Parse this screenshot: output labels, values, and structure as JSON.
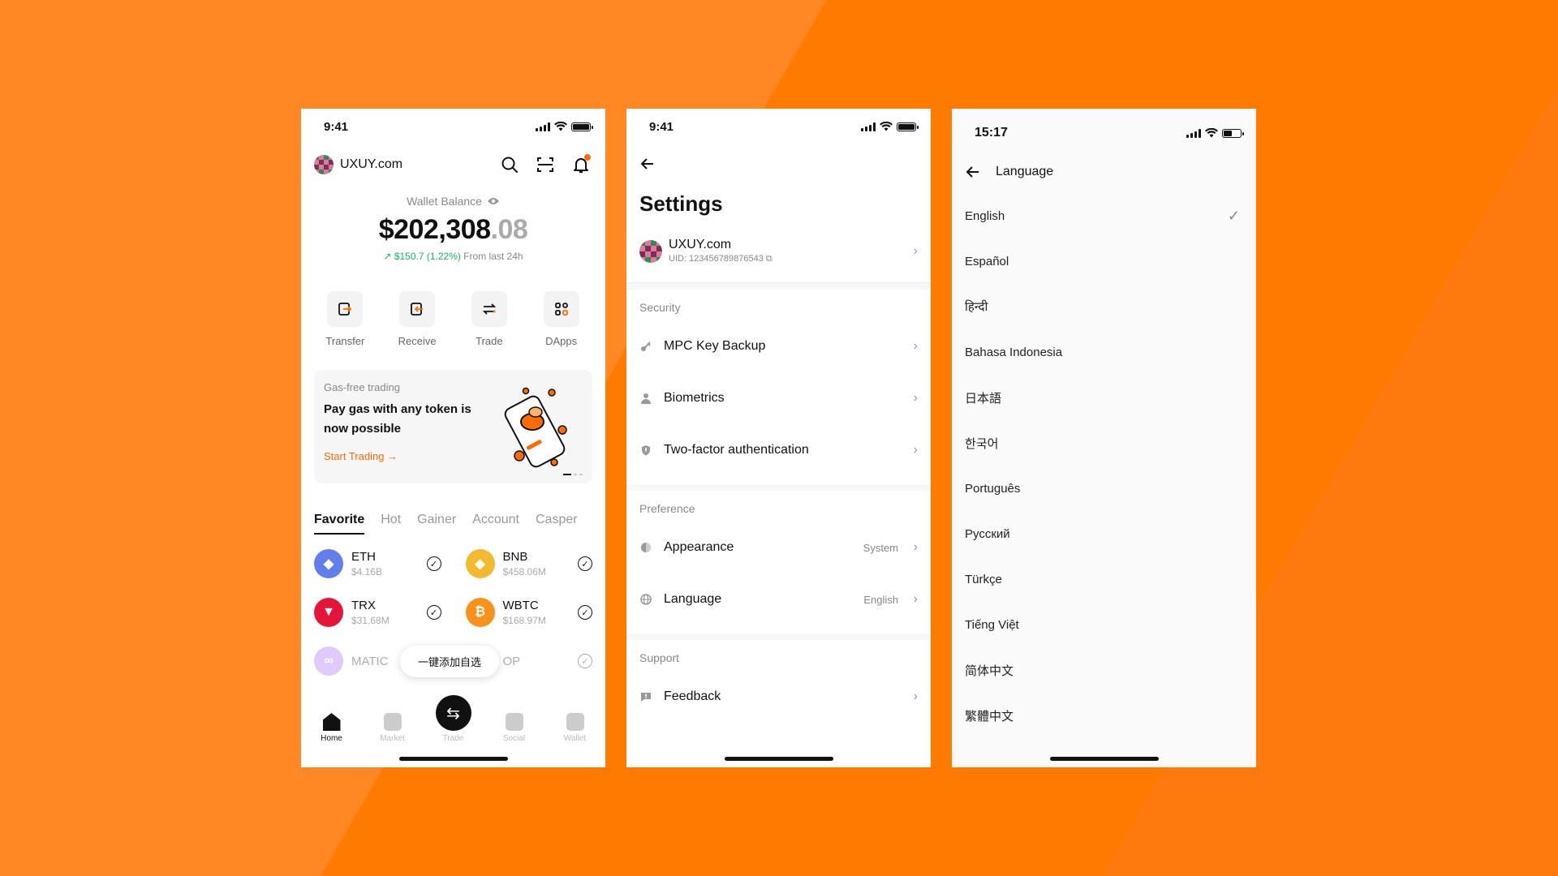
{
  "colors": {
    "accent": "#ff6b00",
    "background": "#ff7a00",
    "positive": "#18b85a"
  },
  "home": {
    "status": {
      "time": "9:41"
    },
    "brand": "UXUY.com",
    "balance_label": "Wallet Balance",
    "balance_main": "$202,308",
    "balance_decimal": ".08",
    "change_value": "$150.7 (1.22%)",
    "change_suffix": "From last 24h",
    "actions": [
      {
        "label": "Transfer",
        "icon": "transfer-icon"
      },
      {
        "label": "Receive",
        "icon": "receive-icon"
      },
      {
        "label": "Trade",
        "icon": "trade-icon"
      },
      {
        "label": "DApps",
        "icon": "dapps-icon"
      }
    ],
    "promo": {
      "subtitle": "Gas-free trading",
      "title": "Pay gas with any token is now possible",
      "link": "Start Trading →"
    },
    "tabs": [
      "Favorite",
      "Hot",
      "Gainer",
      "Account",
      "Casper"
    ],
    "coins": [
      {
        "name": "ETH",
        "cap": "$4.16B",
        "color": "#627eea",
        "glyph": "◆"
      },
      {
        "name": "BNB",
        "cap": "$458.06M",
        "color": "#f3ba2f",
        "glyph": "◈"
      },
      {
        "name": "TRX",
        "cap": "$31.68M",
        "color": "#e5143a",
        "glyph": "▼"
      },
      {
        "name": "WBTC",
        "cap": "$168.97M",
        "color": "#f7931a",
        "glyph": "₿"
      },
      {
        "name": "MATIC",
        "cap": "",
        "color": "#a46bf5",
        "glyph": "∞"
      },
      {
        "name": "OP",
        "cap": "",
        "color": "#ff0420",
        "glyph": "OP"
      }
    ],
    "toast": "一键添加自选",
    "tabbar": [
      "Home",
      "Market",
      "Trade",
      "Social",
      "Wallet"
    ]
  },
  "settings": {
    "status": {
      "time": "9:41"
    },
    "title": "Settings",
    "profile_name": "UXUY.com",
    "profile_uid": "UID: 123456789876543",
    "security_header": "Security",
    "security": [
      {
        "label": "MPC Key Backup",
        "icon": "key-icon"
      },
      {
        "label": "Biometrics",
        "icon": "user-icon"
      },
      {
        "label": "Two-factor authentication",
        "icon": "shield-icon"
      }
    ],
    "preference_header": "Preference",
    "preference": [
      {
        "label": "Appearance",
        "value": "System",
        "icon": "appearance-icon"
      },
      {
        "label": "Language",
        "value": "English",
        "icon": "globe-icon"
      }
    ],
    "support_header": "Support",
    "support": [
      {
        "label": "Feedback",
        "icon": "feedback-icon"
      }
    ]
  },
  "language": {
    "status": {
      "time": "15:17"
    },
    "title": "Language",
    "items": [
      "English",
      "Español",
      "हिन्दी",
      "Bahasa Indonesia",
      "日本語",
      "한국어",
      "Português",
      "Русский",
      "Türkçe",
      "Tiếng Việt",
      "简体中文",
      "繁體中文"
    ],
    "selected_index": 0
  }
}
